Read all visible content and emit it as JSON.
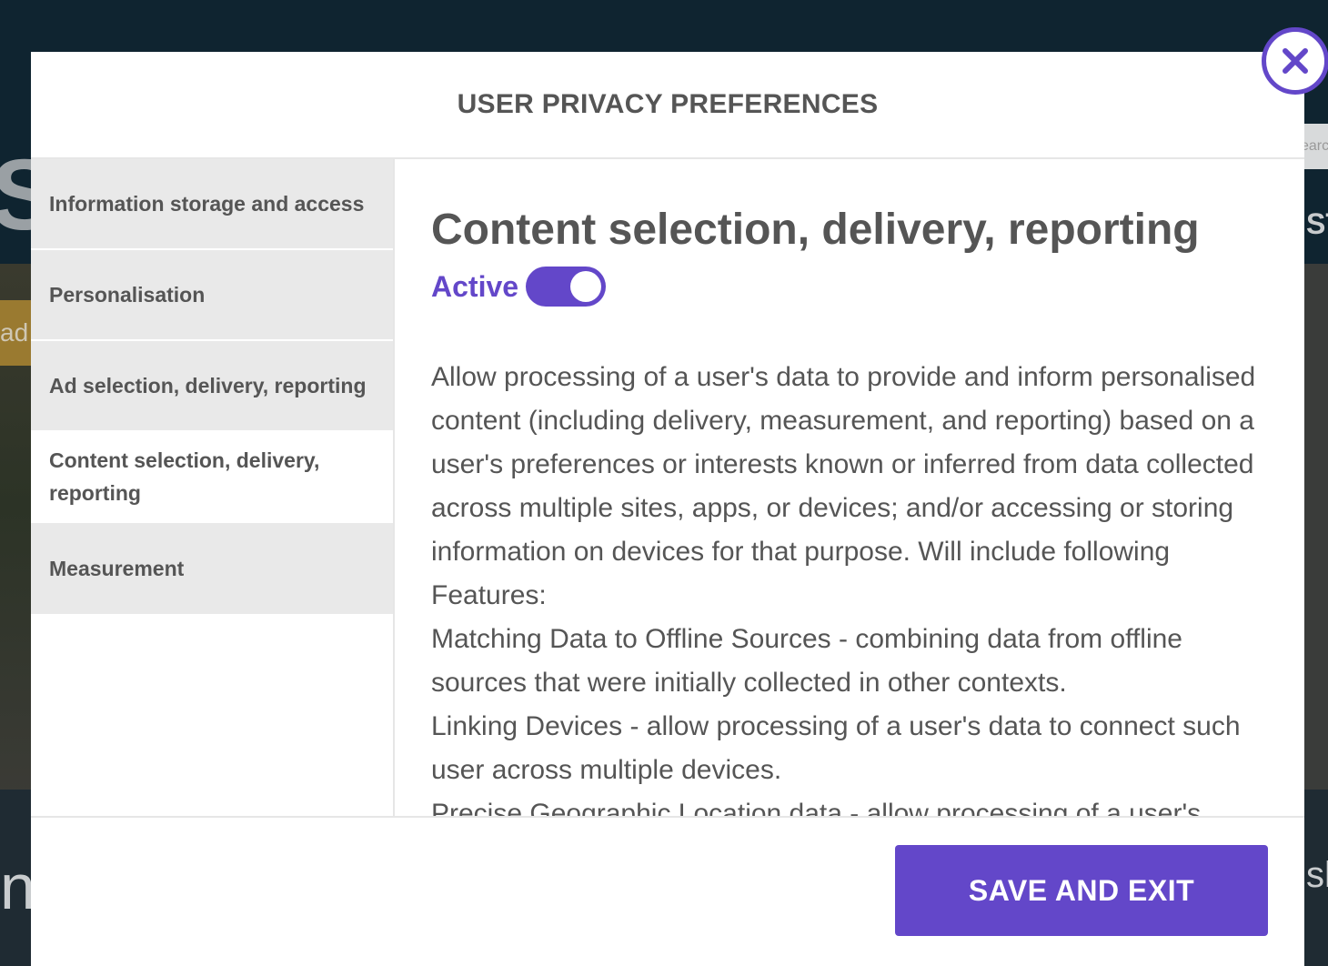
{
  "modal": {
    "title": "USER PRIVACY PREFERENCES",
    "close_icon": "close-icon"
  },
  "sidebar": {
    "items": [
      {
        "label": "Information storage and access",
        "active": false
      },
      {
        "label": "Personalisation",
        "active": false
      },
      {
        "label": "Ad selection, delivery, reporting",
        "active": false
      },
      {
        "label": "Content selection, delivery, reporting",
        "active": true
      },
      {
        "label": "Measurement",
        "active": false
      }
    ]
  },
  "content": {
    "heading": "Content selection, delivery, reporting",
    "status_label": "Active",
    "toggle_on": true,
    "paragraphs": [
      "Allow processing of a user's data to provide and inform personalised content (including delivery, measurement, and reporting) based on a user's preferences or interests known or inferred from data collected across multiple sites, apps, or devices; and/or accessing or storing information on devices for that purpose. Will include following Features:",
      "Matching Data to Offline Sources - combining data from offline sources that were initially collected in other contexts.",
      "Linking Devices - allow processing of a user's data to connect such user across multiple devices.",
      "Precise Geographic Location data - allow processing of a user's"
    ]
  },
  "footer": {
    "save_label": "SAVE AND EXIT"
  },
  "colors": {
    "accent": "#6347c9",
    "text": "#555555",
    "sidebar_bg": "#e9e9e9"
  }
}
